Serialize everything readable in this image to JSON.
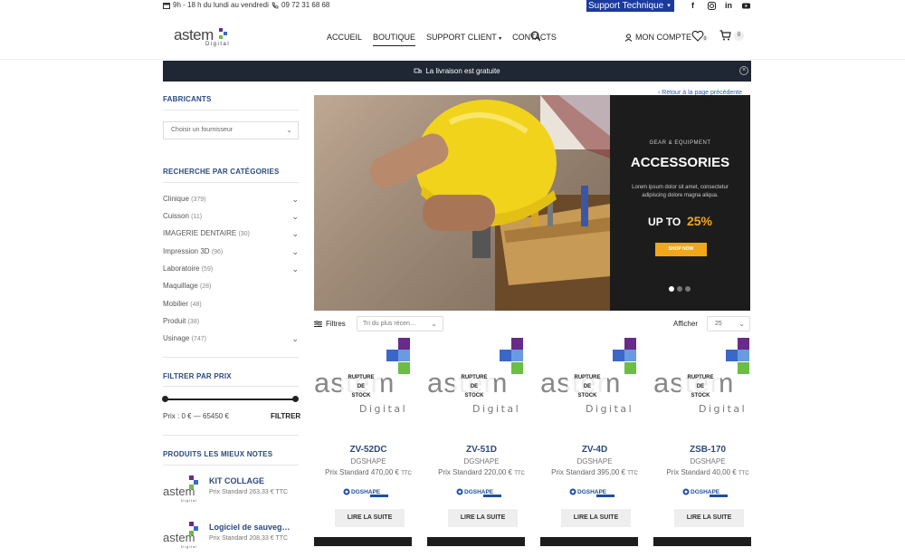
{
  "topbar": {
    "hours": "9h - 18 h du lundi au vendredi",
    "phone": "09 72 31 68 68",
    "support": "Support Technique",
    "social": [
      "f",
      "ig",
      "in",
      "yt"
    ]
  },
  "header": {
    "logo_word": "astem",
    "logo_sub": "Digital",
    "nav": [
      "ACCUEIL",
      "BOUTIQUE",
      "SUPPORT CLIENT",
      "CONTACTS"
    ],
    "account": "MON COMPTE",
    "wishlist_count": "0",
    "cart_count": "0"
  },
  "notice": {
    "text": "La livraison est gratuite"
  },
  "sidebar": {
    "fabricants_title": "FABRICANTS",
    "supplier_placeholder": "Choisir un fournisseur",
    "categories_title": "RECHERCHE PAR CATÉGORIES",
    "categories": [
      {
        "label": "Clinique",
        "count": "(379)",
        "expandable": true
      },
      {
        "label": "Cuisson",
        "count": "(11)",
        "expandable": true
      },
      {
        "label": "IMAGERIE DENTAIRE",
        "count": "(30)",
        "expandable": true
      },
      {
        "label": "Impression 3D",
        "count": "(96)",
        "expandable": true
      },
      {
        "label": "Laboratoire",
        "count": "(59)",
        "expandable": true
      },
      {
        "label": "Maquillage",
        "count": "(28)",
        "expandable": false
      },
      {
        "label": "Mobilier",
        "count": "(48)",
        "expandable": false
      },
      {
        "label": "Produit",
        "count": "(38)",
        "expandable": false
      },
      {
        "label": "Usinage",
        "count": "(747)",
        "expandable": true
      }
    ],
    "price_title": "FILTRER PAR PRIX",
    "price_range": "Prix : 0 € — 65450 €",
    "filter_button": "FILTRER",
    "top_rated_title": "PRODUITS LES MIEUX NOTES",
    "top_rated": [
      {
        "name": "KIT COLLAGE",
        "price": "Prix Standard 263,33 € TTC"
      },
      {
        "name": "Logiciel de sauveg…",
        "price": "Prix Standard 208,33 € TTC"
      }
    ]
  },
  "hero": {
    "back_link": "‹ Retour à la page précédente",
    "eyebrow": "GEAR & EQUIPMENT",
    "headline": "ACCESSORIES",
    "desc": "Lorem ipsum dolor sit amet, consectetur adipiscing dolore magna aliqua.",
    "upto": "UP TO",
    "percent": "25%",
    "shop": "SHOP NOW",
    "active_slide": 1
  },
  "toolbar": {
    "filters": "Filtres",
    "sort": "Tri du plus récen…",
    "afficher": "Afficher",
    "per_page": "25"
  },
  "products": [
    {
      "title": "ZV-52DC",
      "brand": "DGSHAPE",
      "price": "Prix Standard 470,00 €",
      "ttc": "TTC",
      "stock": "RUPTURE DE STOCK",
      "button": "LIRE LA SUITE"
    },
    {
      "title": "ZV-51D",
      "brand": "DGSHAPE",
      "price": "Prix Standard 220,00 €",
      "ttc": "TTC",
      "stock": "RUPTURE DE STOCK",
      "button": "LIRE LA SUITE"
    },
    {
      "title": "ZV-4D",
      "brand": "DGSHAPE",
      "price": "Prix Standard 395,00 €",
      "ttc": "TTC",
      "stock": "RUPTURE DE STOCK",
      "button": "LIRE LA SUITE"
    },
    {
      "title": "ZSB-170",
      "brand": "DGSHAPE",
      "price": "Prix Standard 40,00 €",
      "ttc": "TTC",
      "stock": "RUPTURE DE STOCK",
      "button": "LIRE LA SUITE"
    }
  ],
  "colors": {
    "accent": "#2a4a7f",
    "notice": "#1e2733",
    "support": "#1a3aa0",
    "promo": "#f2a71b"
  }
}
